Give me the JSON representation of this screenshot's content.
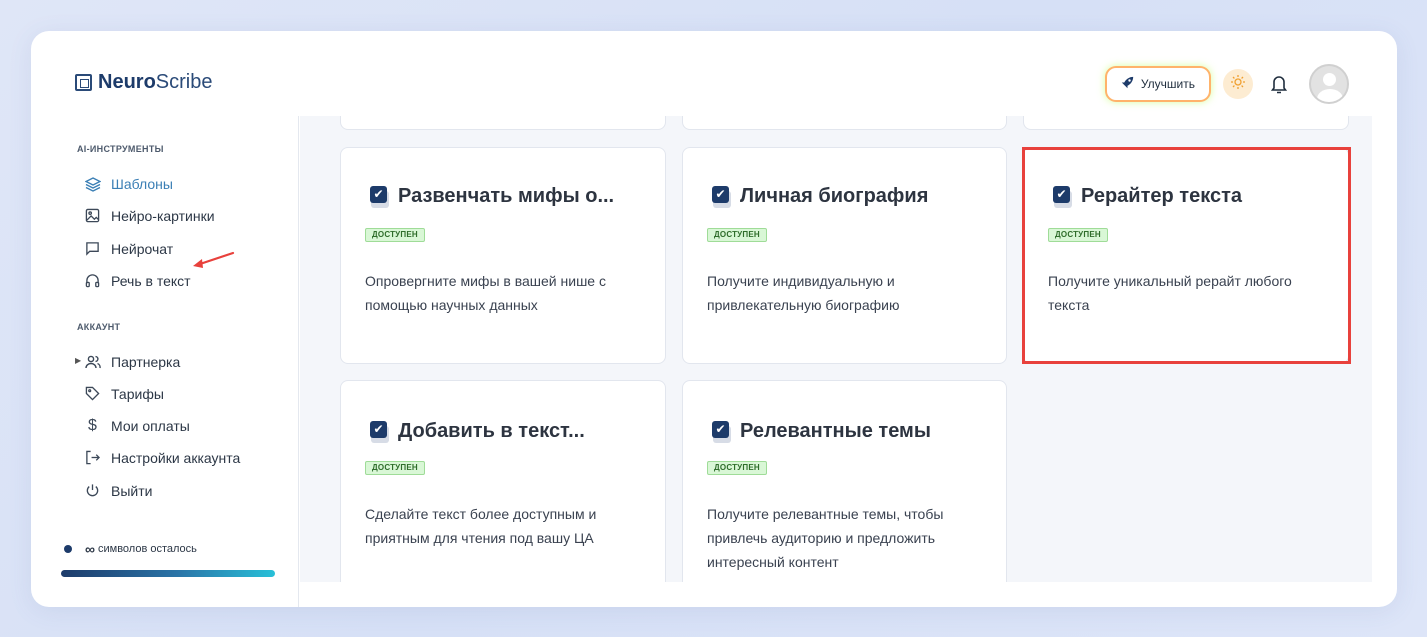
{
  "app": {
    "brand_bold": "Neuro",
    "brand_light": "Scribe"
  },
  "topbar": {
    "upgrade_label": "Улучшить",
    "icons": [
      "rocket-icon",
      "sun-icon",
      "bell-icon",
      "avatar"
    ]
  },
  "sidebar": {
    "section_tools": "AI-ИНСТРУМЕНТЫ",
    "tools": [
      {
        "label": "Шаблоны",
        "icon": "layers-icon",
        "active": true
      },
      {
        "label": "Нейро-картинки",
        "icon": "image-icon"
      },
      {
        "label": "Нейрочат",
        "icon": "chat-icon"
      },
      {
        "label": "Речь в текст",
        "icon": "headphones-icon"
      }
    ],
    "section_account": "АККАУНТ",
    "account": [
      {
        "label": "Партнерка",
        "icon": "users-icon",
        "expandable": true
      },
      {
        "label": "Тарифы",
        "icon": "tag-icon"
      },
      {
        "label": "Мои оплаты",
        "icon": "dollar-icon"
      },
      {
        "label": "Настройки аккаунта",
        "icon": "logout-arrow-icon"
      },
      {
        "label": "Выйти",
        "icon": "power-icon"
      }
    ],
    "credits_symbol": "∞",
    "credits_text": "символов осталось"
  },
  "cards": [
    {
      "title": "Развенчать мифы о...",
      "badge": "ДОСТУПЕН",
      "desc": "Опровергните мифы в вашей нише с помощью научных данных"
    },
    {
      "title": "Личная биография",
      "badge": "ДОСТУПЕН",
      "desc": "Получите индивидуальную и привлекательную биографию"
    },
    {
      "title": "Рерайтер текста",
      "badge": "ДОСТУПЕН",
      "desc": "Получите уникальный рерайт любого текста",
      "highlighted": true
    },
    {
      "title": "Добавить в текст...",
      "badge": "ДОСТУПЕН",
      "desc": "Сделайте текст более доступным и приятным для чтения под вашу ЦА"
    },
    {
      "title": "Релевантные темы",
      "badge": "ДОСТУПЕН",
      "desc": "Получите релевантные темы, чтобы привлечь аудиторию и предложить интересный контент"
    }
  ],
  "colors": {
    "accent": "#1d3b6a",
    "active_nav": "#3b7fb5",
    "highlight": "#e8413c",
    "badge_bg": "#d9f7d6"
  }
}
